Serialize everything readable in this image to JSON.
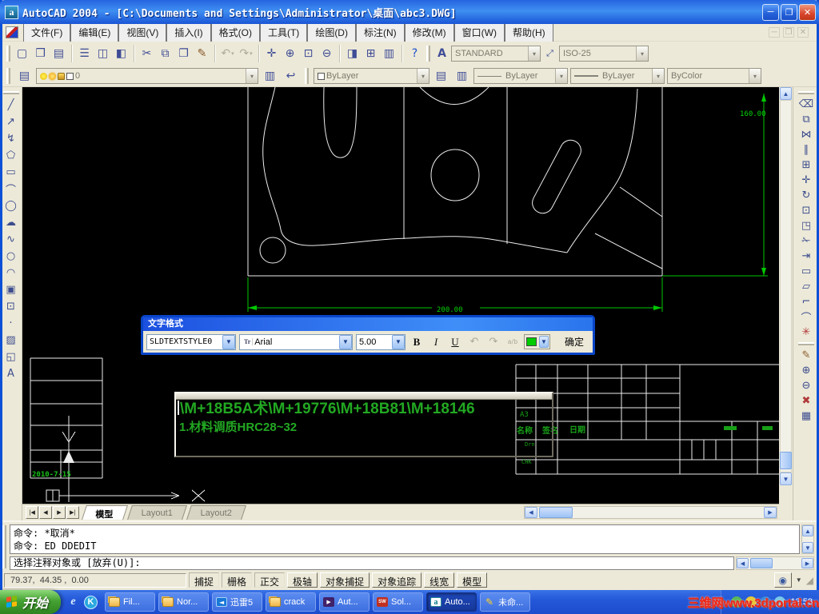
{
  "window": {
    "title": "AutoCAD 2004 - [C:\\Documents and Settings\\Administrator\\桌面\\abc3.DWG]",
    "min": "─",
    "max": "❐",
    "close": "✕"
  },
  "menu": {
    "items": [
      "文件(F)",
      "编辑(E)",
      "视图(V)",
      "插入(I)",
      "格式(O)",
      "工具(T)",
      "绘图(D)",
      "标注(N)",
      "修改(M)",
      "窗口(W)",
      "帮助(H)"
    ]
  },
  "standard_toolbar": [
    {
      "name": "new-file-button",
      "g": "▢"
    },
    {
      "name": "open-file-button",
      "g": "❒"
    },
    {
      "name": "save-button",
      "g": "▤"
    },
    {
      "sep": true
    },
    {
      "name": "print-button",
      "g": "☰"
    },
    {
      "name": "print-preview-button",
      "g": "◫"
    },
    {
      "name": "publish-button",
      "g": "◧"
    },
    {
      "sep": true
    },
    {
      "name": "cut-button",
      "g": "✂"
    },
    {
      "name": "copy-button",
      "g": "⧉"
    },
    {
      "name": "paste-button",
      "g": "❐"
    },
    {
      "name": "match-properties-button",
      "g": "✎",
      "c": "#8a5b2b"
    },
    {
      "sep": true
    },
    {
      "name": "undo-button",
      "g": "↶",
      "c": "#b0ab9d",
      "caret": true
    },
    {
      "name": "redo-button",
      "g": "↷",
      "c": "#b0ab9d",
      "caret": true
    },
    {
      "sep": true
    },
    {
      "name": "pan-button",
      "g": "✛"
    },
    {
      "name": "zoom-realtime-button",
      "g": "⊕"
    },
    {
      "name": "zoom-window-button",
      "g": "⊡"
    },
    {
      "name": "zoom-previous-button",
      "g": "⊖"
    },
    {
      "sep": true
    },
    {
      "name": "properties-palette-button",
      "g": "◨"
    },
    {
      "name": "designcenter-button",
      "g": "⊞"
    },
    {
      "name": "tool-palettes-button",
      "g": "▥"
    },
    {
      "sep": true
    },
    {
      "name": "help-button",
      "g": "?",
      "c": "#1a50c8"
    }
  ],
  "styles_toolbar": {
    "text_style": "STANDARD",
    "dim_style": "ISO-25"
  },
  "layers_toolbar": {
    "layer": "0"
  },
  "properties_toolbar": {
    "color": "ByLayer",
    "linetype": "ByLayer",
    "lineweight": "ByLayer",
    "plot_style": "ByColor"
  },
  "draw_toolbar": [
    {
      "name": "line-button",
      "g": "╱"
    },
    {
      "name": "construction-line-button",
      "g": "↗"
    },
    {
      "name": "polyline-button",
      "g": "↯"
    },
    {
      "name": "polygon-button",
      "g": "⬠"
    },
    {
      "name": "rectangle-button",
      "g": "▭"
    },
    {
      "name": "arc-button",
      "g": "⌒"
    },
    {
      "name": "circle-button",
      "g": "◯"
    },
    {
      "name": "revision-cloud-button",
      "g": "☁"
    },
    {
      "name": "spline-button",
      "g": "∿"
    },
    {
      "name": "ellipse-button",
      "g": "○"
    },
    {
      "name": "ellipse-arc-button",
      "g": "◠"
    },
    {
      "name": "insert-block-button",
      "g": "▣"
    },
    {
      "name": "make-block-button",
      "g": "⊡"
    },
    {
      "name": "point-button",
      "g": "·"
    },
    {
      "name": "hatch-button",
      "g": "▨"
    },
    {
      "name": "region-button",
      "g": "◱"
    },
    {
      "name": "multiline-text-button",
      "g": "A"
    }
  ],
  "modify_toolbar": [
    {
      "name": "erase-button",
      "g": "⌫"
    },
    {
      "name": "copy-object-button",
      "g": "⧉"
    },
    {
      "name": "mirror-button",
      "g": "⋈"
    },
    {
      "name": "offset-button",
      "g": "∥"
    },
    {
      "name": "array-button",
      "g": "⊞"
    },
    {
      "name": "move-button",
      "g": "✛"
    },
    {
      "name": "rotate-button",
      "g": "↻"
    },
    {
      "name": "scale-button",
      "g": "⊡"
    },
    {
      "name": "stretch-button",
      "g": "◳"
    },
    {
      "name": "trim-button",
      "g": "✁"
    },
    {
      "name": "extend-button",
      "g": "⇥"
    },
    {
      "name": "break-at-point-button",
      "g": "▭"
    },
    {
      "name": "break-button",
      "g": "▱"
    },
    {
      "name": "chamfer-button",
      "g": "⌐"
    },
    {
      "name": "fillet-button",
      "g": "⌒"
    },
    {
      "name": "explode-button",
      "g": "✳",
      "c": "#b03838"
    }
  ],
  "refedit_toolbar": [
    {
      "name": "edit-reference-button",
      "g": "✎",
      "c": "#8a5b2b"
    },
    {
      "name": "add-to-workset-button",
      "g": "⊕"
    },
    {
      "name": "remove-from-workset-button",
      "g": "⊖"
    },
    {
      "name": "close-reference-button",
      "g": "✖",
      "c": "#b03838"
    },
    {
      "name": "save-reference-edits-button",
      "g": "▦"
    }
  ],
  "dialog": {
    "title": "文字格式",
    "style": "SLDTEXTSTYLE0",
    "font": "Arial",
    "tt": "Tr",
    "height": "5.00",
    "bold": "B",
    "italic": "I",
    "underline": "U",
    "undo": "↶",
    "redo": "↷",
    "stack": "a/b",
    "color": "#00cc00",
    "ok": "确定"
  },
  "text_editor": {
    "line1": "\\M+18B5A术\\M+19776\\M+18B81\\M+18146",
    "line2": "1.材料调质HRC28~32"
  },
  "drawing": {
    "dim_h": "200.00",
    "dim_v": "160.00",
    "date": "2010-7-15",
    "titleblock": {
      "a3": "A3",
      "name": "名称",
      "sign": "签名",
      "date": "日期",
      "drn": "Drn",
      "chk": "CHK"
    }
  },
  "tabs": {
    "nav": [
      "|◀",
      "◀",
      "▶",
      "▶|"
    ],
    "items": [
      {
        "name": "tab-model",
        "label": "模型",
        "active": true
      },
      {
        "name": "tab-layout1",
        "label": "Layout1"
      },
      {
        "name": "tab-layout2",
        "label": "Layout2"
      }
    ]
  },
  "command": {
    "history": [
      "命令: *取消*",
      "命令: ED DDEDIT"
    ],
    "prompt": "选择注释对象或 [放弃(U)]:"
  },
  "status": {
    "coords": "79.37,  44.35 ,  0.00",
    "toggles": [
      {
        "name": "toggle-snap",
        "label": "捕捉"
      },
      {
        "name": "toggle-grid",
        "label": "栅格"
      },
      {
        "name": "toggle-ortho",
        "label": "正交"
      },
      {
        "name": "toggle-polar",
        "label": "极轴",
        "on": true
      },
      {
        "name": "toggle-osnap",
        "label": "对象捕捉",
        "on": true
      },
      {
        "name": "toggle-otrack",
        "label": "对象追踪",
        "on": true
      },
      {
        "name": "toggle-lineweight",
        "label": "线宽",
        "on": true
      },
      {
        "name": "toggle-model",
        "label": "模型",
        "on": true
      }
    ]
  },
  "taskbar": {
    "start": "开始",
    "buttons": [
      {
        "name": "task-fil",
        "label": "Fil...",
        "icon": "folder"
      },
      {
        "name": "task-nor",
        "label": "Nor...",
        "icon": "folder"
      },
      {
        "name": "task-xunlei5",
        "label": "迅雷5",
        "icon": "thunder"
      },
      {
        "name": "task-crack",
        "label": "crack",
        "icon": "folder"
      },
      {
        "name": "task-aut",
        "label": "Aut...",
        "icon": "player"
      },
      {
        "name": "task-solidworks",
        "label": "Sol...",
        "icon": "solidworks"
      },
      {
        "name": "task-autocad",
        "label": "Auto...",
        "icon": "autocad",
        "active": true
      },
      {
        "name": "task-untitled",
        "label": "未命...",
        "icon": "pen"
      }
    ],
    "clock": "13:58",
    "watermark": "三维网www.3dportal.cn"
  }
}
